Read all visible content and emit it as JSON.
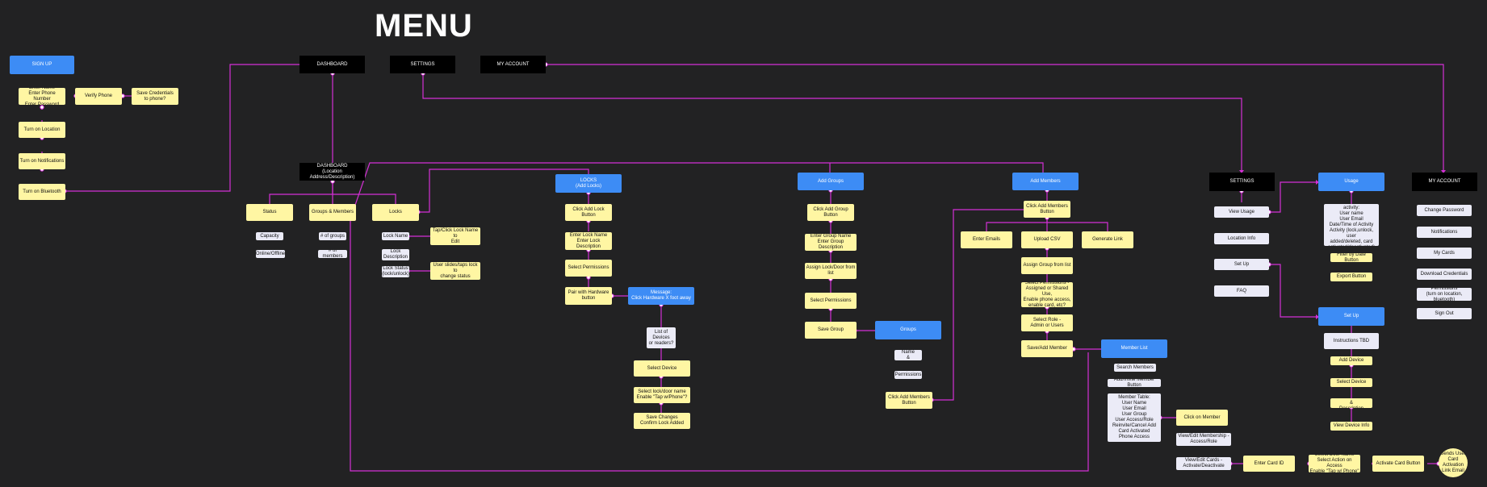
{
  "title": "MENU",
  "colors": {
    "background": "#222223",
    "connector": "#d42fd6",
    "blue": "#3d8cf5",
    "yellow": "#fff6a3",
    "gray": "#ebebf7",
    "black": "#000000"
  },
  "nodes": {
    "signup": "SIGN UP",
    "enter_name": "Enter Name\nEnter Phone Number\nEnter Password",
    "verify_phone": "Verify Phone",
    "save_credentials": "Save Credentials\nto phone?",
    "turn_on_location": "Turn on Location",
    "turn_on_notifications": "Turn on Notifications",
    "turn_on_bluetooth": "Turn on Bluetooth",
    "dashboard_top": "DASHBOARD",
    "settings_top": "SETTINGS",
    "myaccount_top": "MY ACCOUNT",
    "dashboard": "DASHBOARD\n(Location Address/Description)",
    "status": "Status",
    "groups_members": "Groups & Members",
    "locks": "Locks",
    "capacity": "Capacity",
    "online_offline": "Online/Offline",
    "num_groups": "# of groups",
    "num_members": "# of members",
    "lock_name": "Lock Name",
    "lock_description": "Lock\nDescription",
    "lock_status": "Lock Status\n(lock/unlock)",
    "tap_click_lock_name": "Tap/Click Lock Name to\nEdit",
    "user_slides": "User slides/taps lock to\nchange status",
    "locks_add": "LOCKS\n(Add Locks)",
    "click_add_lock": "Click Add Lock Button",
    "enter_lock_name": "Enter Lock Name\nEnter Lock Description",
    "select_permissions_lock": "Select Permissions",
    "pair_hardware": "Pair with Hardware\nbutton",
    "message_hardware": "Message:\nClick Hardware X foot away",
    "list_devices": "List of Devices\nor readers?",
    "select_device_lock": "Select Device",
    "select_lock_door": "Select lock/door name\nEnable \"Tap w/Phone\"?",
    "save_changes": "Save Changes\nConfirm Lock Added",
    "add_groups": "Add Groups",
    "click_add_group": "Click Add Group Button",
    "enter_group_name": "Enter Group Name\nEnter Group Description",
    "assign_lock_door": "Assign Lock/Door from list",
    "select_permissions_group": "Select Permissions",
    "save_group": "Save Group",
    "groups": "Groups",
    "group_name_desc": "Group Name\n& Description",
    "permissions_group": "Permissions",
    "click_add_members_group": "Click Add Members\nButton",
    "add_members": "Add Members",
    "click_add_members": "Click Add Members\nButton",
    "enter_emails": "Enter Emails",
    "upload_csv": "Upload CSV",
    "generate_link": "Generate Link",
    "assign_group_list": "Assign Group from list",
    "select_permissions_member": "Select Permissions -\nAssigned or Shared Use,\nEnable phone access,\nenable card, etc?",
    "select_role": "Select Role -\nAdmin or Users",
    "save_add_member": "Save/Add Member",
    "member_list": "Member List",
    "search_members": "Search Members",
    "add_invite_member": "Add/Invite Member Button",
    "member_table": "Member Table:\nUser Name\nUser Email\nUser Group\nUser Access/Role\nReinvite/Cancel Add\nCard Activated\nPhone Access",
    "click_on_member": "Click on Member",
    "view_edit_membership": "View/Edit Membership -\nAccess/Role",
    "view_edit_cards": "View/Edit Cards -\nActivate/Deactivate",
    "enter_card_id": "Enter Card ID",
    "select_door_name": "Select Door Name\nSelect Action on Access\nEnable \"Tap w/ Phone\"",
    "activate_card": "Activate Card Button",
    "sends_user": "Sends User\nCard Activation\nLink Email",
    "settings": "SETTINGS",
    "view_usage": "View Usage",
    "location_info": "Location Info",
    "set_up_settings": "Set Up",
    "faq": "FAQ",
    "usage": "Usage",
    "view_list_activity": "View list of recent activity:\nUser name\nUser Email\nDate/Time of Activity\nActivity (lock,unlock, user\nadded/deleted, card\nactivated/deactivated)",
    "filter_date": "Filter by Date Button",
    "export_button": "Export Button",
    "set_up_blue": "Set Up",
    "instructions_tbd": "Instructions TBD",
    "add_device": "Add Device",
    "select_device_setup": "Select Device",
    "edit_device_name": "Edit Device Name &\nDescription",
    "view_device_info": "View Device Info",
    "my_account": "MY ACCOUNT",
    "change_password": "Change Password",
    "notifications": "Notifications",
    "my_cards": "My Cards",
    "download_credentials": "Download Credentials",
    "permissions_account": "Permissions\n(turn on location, bluetooth)",
    "sign_out": "Sign Out"
  }
}
